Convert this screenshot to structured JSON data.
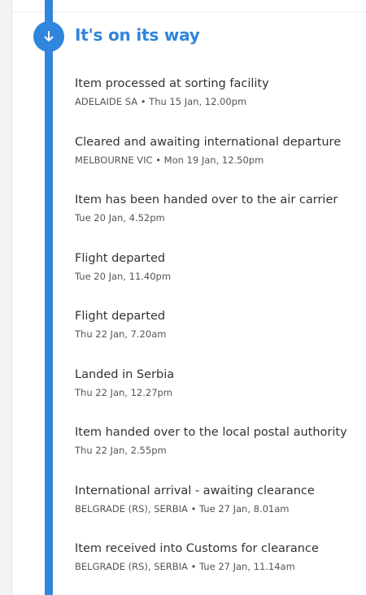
{
  "header": {
    "status_title": "It's on its way",
    "status_icon": "arrow-down-icon",
    "accent_color": "#2f86dc"
  },
  "events": [
    {
      "title": "Item processed at sorting facility",
      "detail": "ADELAIDE SA • Thu 15 Jan, 12.00pm"
    },
    {
      "title": "Cleared and awaiting international departure",
      "detail": "MELBOURNE VIC • Mon 19 Jan, 12.50pm"
    },
    {
      "title": "Item has been handed over to the air carrier",
      "detail": "Tue 20 Jan, 4.52pm"
    },
    {
      "title": "Flight departed",
      "detail": "Tue 20 Jan, 11.40pm"
    },
    {
      "title": "Flight departed",
      "detail": "Thu 22 Jan, 7.20am"
    },
    {
      "title": "Landed in Serbia",
      "detail": "Thu 22 Jan, 12.27pm"
    },
    {
      "title": "Item handed over to the local postal authority",
      "detail": "Thu 22 Jan, 2.55pm"
    },
    {
      "title": "International arrival - awaiting clearance",
      "detail": "BELGRADE (RS), SERBIA • Tue 27 Jan, 8.01am"
    },
    {
      "title": "Item received into Customs for clearance",
      "detail": "BELGRADE (RS), SERBIA • Tue 27 Jan, 11.14am"
    }
  ]
}
